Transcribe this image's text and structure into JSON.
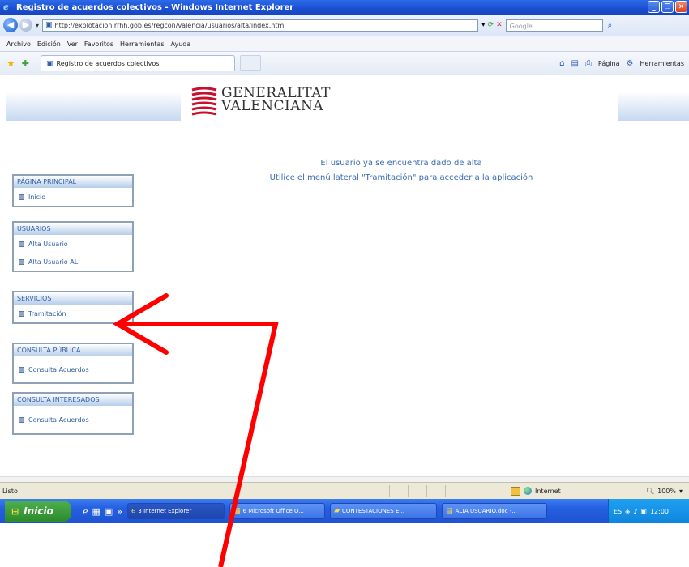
{
  "window": {
    "title": "Registro de acuerdos colectivos - Windows Internet Explorer",
    "buttons": [
      "_",
      "❐",
      "✕"
    ]
  },
  "address_bar": {
    "url": "http://explotacion.rrhh.gob.es/regcon/valencia/usuarios/alta/index.htm",
    "search_placeholder": "Google"
  },
  "menu": [
    "Archivo",
    "Edición",
    "Ver",
    "Favoritos",
    "Herramientas",
    "Ayuda"
  ],
  "tab": {
    "label": "Registro de acuerdos colectivos"
  },
  "command_bar": {
    "page_label": "Página",
    "tools_label": "Herramientas"
  },
  "header": {
    "logo_line1": "GENERALITAT",
    "logo_line2": "VALENCIANA"
  },
  "message": {
    "line1": "El usuario ya se encuentra dado de alta",
    "line2": "Utilice el menú lateral \"Tramitación\" para acceder a la aplicación"
  },
  "sidebar": {
    "panels": [
      {
        "header": "PÁGINA PRINCIPAL",
        "items": [
          "Inicio"
        ]
      },
      {
        "header": "USUARIOS",
        "items": [
          "Alta Usuario",
          "Alta Usuario AL"
        ]
      },
      {
        "header": "SERVICIOS",
        "items": [
          "Tramitación"
        ]
      },
      {
        "header": "CONSULTA PÚBLICA",
        "items": [
          "Consulta Acuerdos"
        ]
      },
      {
        "header": "CONSULTA INTERESADOS",
        "items": [
          "Consulta Acuerdos"
        ]
      }
    ]
  },
  "status_bar": {
    "text": "Listo",
    "zone": "Internet",
    "zoom": "100%"
  },
  "taskbar": {
    "start": "Inicio",
    "tasks": [
      "3 Internet Explorer",
      "6 Microsoft Office O...",
      "CONTESTACIONES E...",
      "ALTA USUARIO.doc -..."
    ],
    "clock": "12:00"
  },
  "annotation": {
    "color": "#ff0000",
    "description": "red-arrow"
  }
}
